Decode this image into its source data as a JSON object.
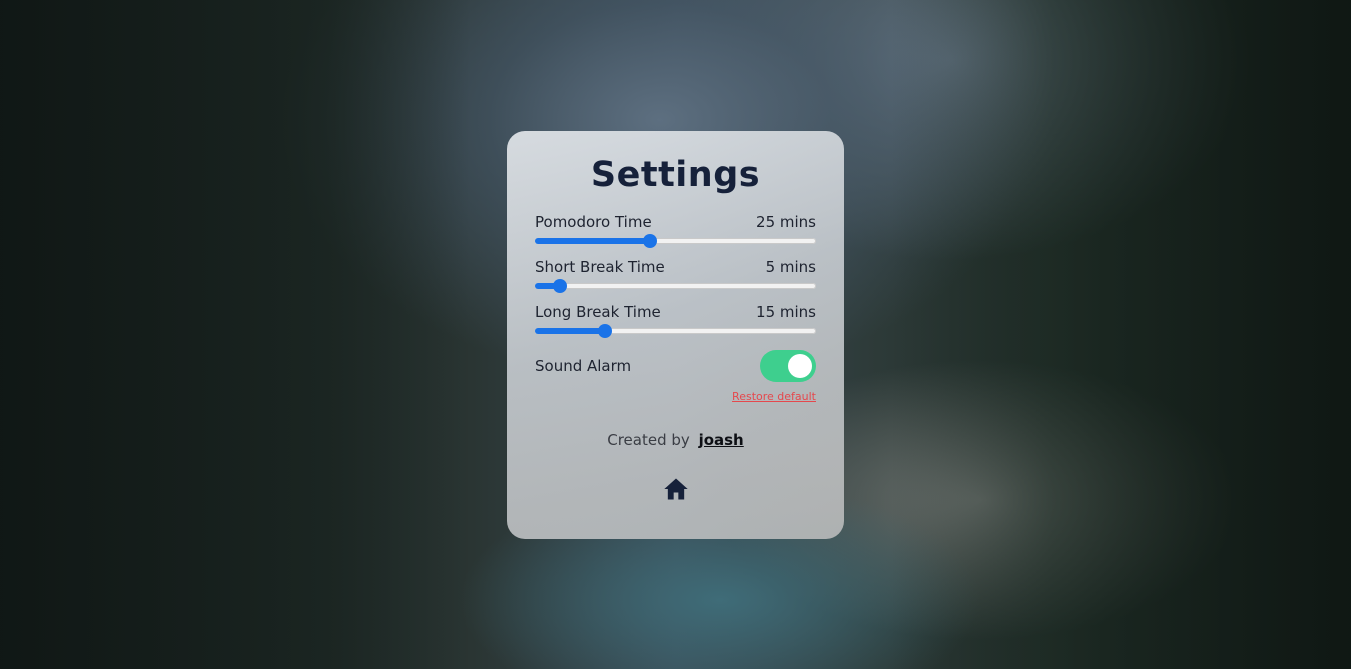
{
  "settings": {
    "title": "Settings",
    "pomodoro": {
      "label": "Pomodoro Time",
      "value_text": "25 mins",
      "fraction": 0.41
    },
    "short_break": {
      "label": "Short Break Time",
      "value_text": "5 mins",
      "fraction": 0.09
    },
    "long_break": {
      "label": "Long Break Time",
      "value_text": "15 mins",
      "fraction": 0.25
    },
    "sound_alarm": {
      "label": "Sound Alarm",
      "enabled": true
    },
    "restore_label": "Restore default",
    "credit_prefix": "Created by",
    "credit_author": "joash"
  },
  "colors": {
    "accent": "#1a73e8",
    "toggle_on": "#3ecf8e",
    "restore_link": "#e5484d",
    "title": "#16213a"
  },
  "icons": {
    "home": "home-icon"
  }
}
